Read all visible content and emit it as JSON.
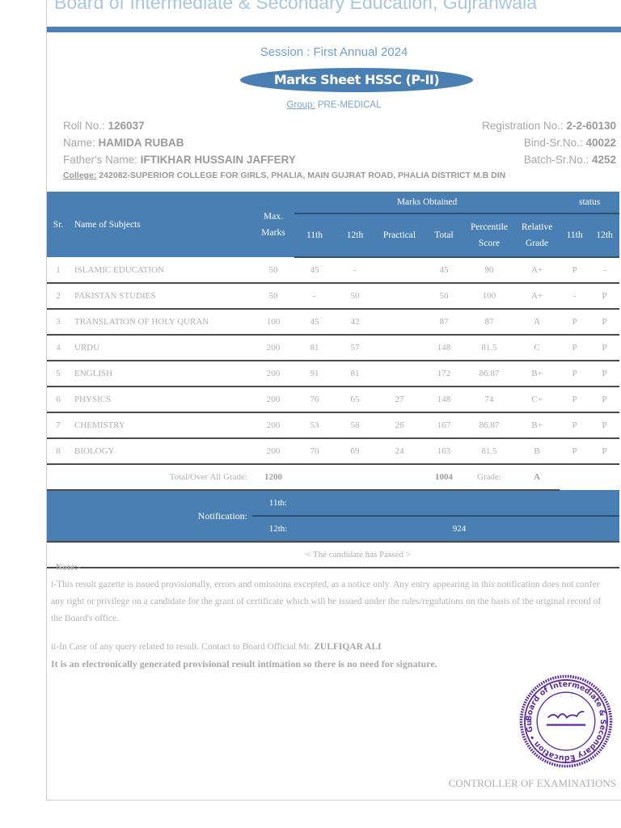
{
  "header": {
    "board_title": "Board of Intermediate & Secondary Education, Gujranwala",
    "session": "Session : First Annual 2024",
    "sheet_title": "Marks Sheet HSSC (P-II)",
    "group_label": "Group:",
    "group_value": "PRE-MEDICAL"
  },
  "student": {
    "roll_label": "Roll No.:",
    "roll": "126037",
    "name_label": "Name:",
    "name": "HAMIDA RUBAB",
    "father_label": "Father's Name:",
    "father": "IFTIKHAR HUSSAIN JAFFERY",
    "college_label": "College:",
    "college": "242082-SUPERIOR COLLEGE FOR GIRLS, PHALIA, MAIN GUJRAT ROAD, PHALIA DISTRICT M.B DIN",
    "reg_label": "Registration No.:",
    "reg": "2-2-60130",
    "bind_label": "Bind-Sr.No.:",
    "bind": "40022",
    "batch_label": "Batch-Sr.No.:",
    "batch": "4252"
  },
  "table": {
    "headers": {
      "sr": "Sr.",
      "name": "Name of Subjects",
      "max": "Max. Marks",
      "obtained": "Marks Obtained",
      "status": "status",
      "h11": "11th",
      "h12": "12th",
      "practical": "Practical",
      "total": "Total",
      "percentile": "Percentile Score",
      "relative": "Relative Grade",
      "s11": "11th",
      "s12": "12th"
    },
    "rows": [
      {
        "sr": "1",
        "name": "ISLAMIC EDUCATION",
        "max": "50",
        "m11": "45",
        "m12": "-",
        "prac": "",
        "total": "45",
        "pct": "90",
        "grade": "A+",
        "s11": "P",
        "s12": "-"
      },
      {
        "sr": "2",
        "name": "PAKISTAN STUDIES",
        "max": "50",
        "m11": "-",
        "m12": "50",
        "prac": "",
        "total": "50",
        "pct": "100",
        "grade": "A+",
        "s11": "-",
        "s12": "P"
      },
      {
        "sr": "3",
        "name": "TRANSLATION OF HOLY QURAN",
        "max": "100",
        "m11": "45",
        "m12": "42",
        "prac": "",
        "total": "87",
        "pct": "87",
        "grade": "A",
        "s11": "P",
        "s12": "P"
      },
      {
        "sr": "4",
        "name": "URDU",
        "max": "200",
        "m11": "81",
        "m12": "57",
        "prac": "",
        "total": "148",
        "pct": "81.5",
        "grade": "C",
        "s11": "P",
        "s12": "P"
      },
      {
        "sr": "5",
        "name": "ENGLISH",
        "max": "200",
        "m11": "91",
        "m12": "81",
        "prac": "",
        "total": "172",
        "pct": "86.87",
        "grade": "B+",
        "s11": "P",
        "s12": "P"
      },
      {
        "sr": "6",
        "name": "PHYSICS",
        "max": "200",
        "m11": "76",
        "m12": "65",
        "prac": "27",
        "total": "148",
        "pct": "74",
        "grade": "C+",
        "s11": "P",
        "s12": "P"
      },
      {
        "sr": "7",
        "name": "CHEMISTRY",
        "max": "200",
        "m11": "53",
        "m12": "58",
        "prac": "26",
        "total": "167",
        "pct": "86.87",
        "grade": "B+",
        "s11": "P",
        "s12": "P"
      },
      {
        "sr": "8",
        "name": "BIOLOGY",
        "max": "200",
        "m11": "70",
        "m12": "69",
        "prac": "24",
        "total": "163",
        "pct": "81.5",
        "grade": "B",
        "s11": "P",
        "s12": "P"
      }
    ],
    "totals": {
      "label": "Total/Over All Grade:",
      "max": "1200",
      "obtained": "1004",
      "grade_label": "Grade:",
      "grade": "A"
    },
    "notification": {
      "label": "Notification:",
      "l11": "11th:",
      "v11": "",
      "l12": "12th:",
      "v12": "924"
    },
    "result": "< The candidate has Passed >"
  },
  "notes": {
    "heading": "Note:-",
    "line1a": "i-This result gazette is issued provisionally, errors and omissions excepted, as a notice only. Any entry appearing in this notification does not",
    "line1b": "confer any right or privilege on a candidate for the grant of certificate which will be issued under the rules/regulations on the basis of the original",
    "line1c": "record of the Board's office.",
    "line2": "ii-In Case of any query related to result. Contact to Board Official Mr.",
    "official": "ZULFIQAR ALI",
    "line3": "It is an electronically generated provisional result intimation so there is no need for signature."
  },
  "stamp": {
    "text": "Board of Intermediate & Secondary Education • Gujranwala •",
    "color": "#5b2a9e"
  },
  "signature": {
    "title": "CONTROLLER OF EXAMINATIONS"
  },
  "colors": {
    "accent": "#4a7fb3"
  }
}
